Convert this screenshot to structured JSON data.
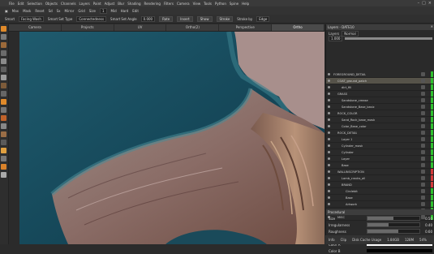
{
  "menubar": {
    "items": [
      "File",
      "Edit",
      "Selection",
      "Objects",
      "Channels",
      "Layers",
      "Paint",
      "Adjust",
      "Blur",
      "Shading",
      "Rendering",
      "Filters",
      "Camera",
      "View",
      "Tools",
      "Python",
      "Spine",
      "Help"
    ]
  },
  "toolbar1": {
    "items": [
      "Max",
      "Mask",
      "Reset",
      "Sd",
      "Sx",
      "Mirror",
      "Grid"
    ],
    "size_label": "Size",
    "size_value": "1",
    "midtone": "Mid",
    "hardness": "Hard",
    "falloff": "Edit"
  },
  "toolbar2": {
    "preset_label": "Smart",
    "preset_value": "Facing Wash",
    "smart_label": "Smart Set Type",
    "smart_value": "Connectedness",
    "smart_angle_label": "Smart Set Angle",
    "smart_angle_value": "0.000",
    "tool_mode": "Rate",
    "btn_insert": "Insert",
    "btn_show": "Show",
    "btn_stroke": "Stroke",
    "stroke_by_label": "Stroke by",
    "stroke_by_value": "Edge"
  },
  "tabs": [
    "Camera",
    "Projects",
    "UV",
    "Ortho(2)",
    "Perspective",
    "Ortho"
  ],
  "active_tab": 5,
  "panel": {
    "title": "Layers",
    "subtitle": "Layers - DATE10",
    "blend_mode": "Normal",
    "opacity": "1.000",
    "layers": [
      {
        "name": "FOREGROUND_DETAIL",
        "indent": 0,
        "mark": "#2fbf2f"
      },
      {
        "name": "COAT_ground_patch",
        "indent": 1,
        "mark": "#2fbf2f",
        "selected": true
      },
      {
        "name": "dirt_fill",
        "indent": 2,
        "mark": "#2fbf2f"
      },
      {
        "name": "GRASS",
        "indent": 1,
        "mark": "#2fbf2f"
      },
      {
        "name": "Sandstone_crease",
        "indent": 2,
        "mark": "#2fbf2f"
      },
      {
        "name": "Sandstone_Base_basic",
        "indent": 2,
        "mark": "#2fbf2f"
      },
      {
        "name": "ROCK_COLOR",
        "indent": 1,
        "mark": "#2fbf2f"
      },
      {
        "name": "Sand_Rock_base_mask",
        "indent": 2,
        "mark": "#2fbf2f"
      },
      {
        "name": "Color_Base_color",
        "indent": 2,
        "mark": "#2fbf2f"
      },
      {
        "name": "ROCK_DETAIL",
        "indent": 1,
        "mark": "#2fbf2f"
      },
      {
        "name": "Layer 1",
        "indent": 2,
        "mark": "#2fbf2f"
      },
      {
        "name": "Cylinder_mask",
        "indent": 2,
        "mark": "#2fbf2f"
      },
      {
        "name": "Cylinder",
        "indent": 2,
        "mark": "#2fbf2f"
      },
      {
        "name": "Layer",
        "indent": 2,
        "mark": "#2fbf2f"
      },
      {
        "name": "Base",
        "indent": 2,
        "mark": "#2fbf2f"
      },
      {
        "name": "WALLINSCRIPTION",
        "indent": 1,
        "mark": "#d23a3a"
      },
      {
        "name": "Lamb_cracks_all",
        "indent": 2,
        "mark": "#d23a3a"
      },
      {
        "name": "BRAND",
        "indent": 2,
        "mark": "#d23a3a"
      },
      {
        "name": "Circlebit",
        "indent": 3,
        "mark": "#2fbf2f"
      },
      {
        "name": "Base",
        "indent": 3,
        "mark": "#2fbf2f"
      },
      {
        "name": "Artwork",
        "indent": 3,
        "mark": "#2fbf2f"
      },
      {
        "name": "MAIN_color",
        "indent": 3,
        "mark": "#2fbf2f"
      },
      {
        "name": "MISC",
        "indent": 1,
        "mark": "#2fbf2f"
      }
    ],
    "procedural": {
      "title": "Procedural",
      "sliders": [
        {
          "label": "Size",
          "value": "0.50",
          "fill": 0.5
        },
        {
          "label": "Irregularness",
          "value": "0.40",
          "fill": 0.4
        },
        {
          "label": "Roughness",
          "value": "0.60",
          "fill": 0.6
        }
      ],
      "color_label": "Colour",
      "color_a_label": "Color A",
      "color_b_label": "Color B"
    }
  },
  "status": {
    "items": [
      "Info",
      "Clip",
      "Disk Cache Usage",
      "1.84GB",
      "128M",
      "54%"
    ]
  },
  "colors": {
    "accent_orange": "#e08a2a",
    "sel_layer": "#56534a"
  }
}
